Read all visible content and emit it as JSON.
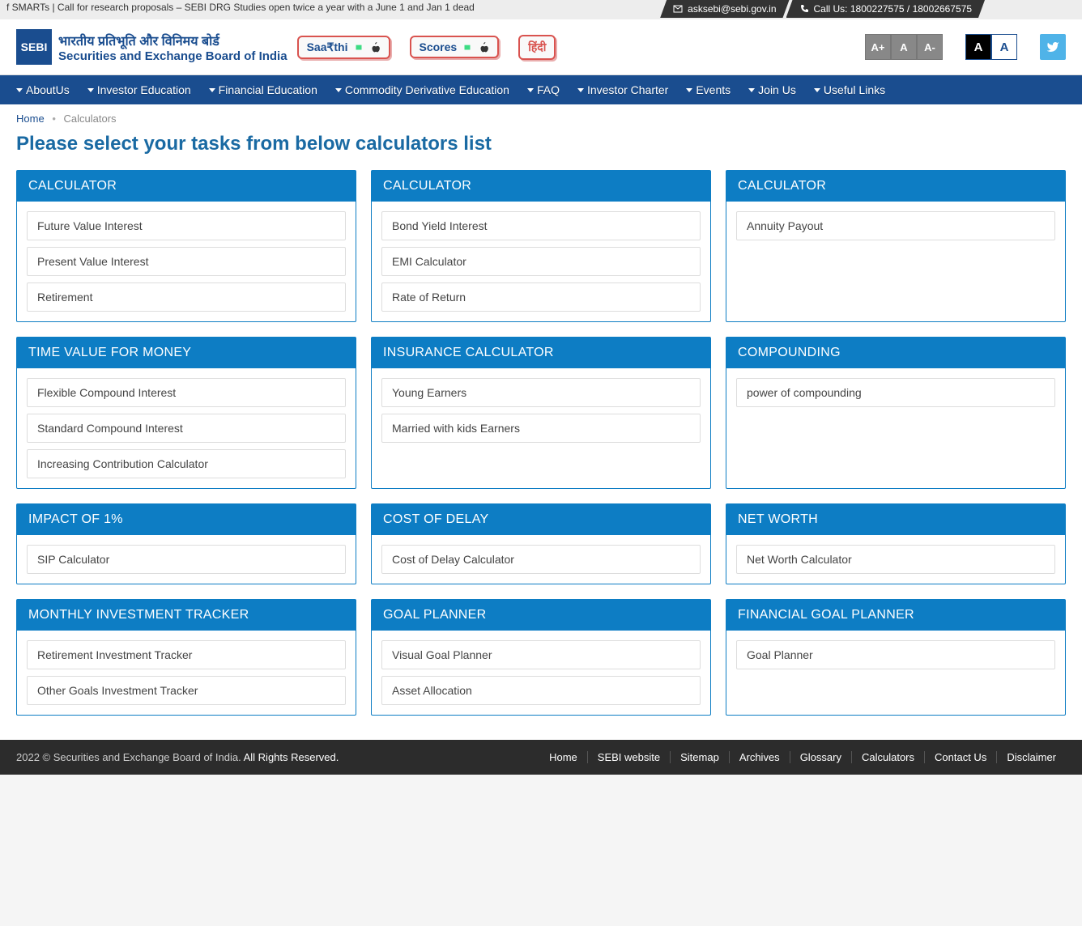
{
  "topbar": {
    "ticker": "f SMARTs   |   Call for research proposals – SEBI DRG Studies open twice a year with a June 1 and Jan 1 dead",
    "email": "asksebi@sebi.gov.in",
    "call": "Call Us: 1800227575 / 18002667575"
  },
  "logo": {
    "square": "SEBI",
    "hindi": "भारतीय प्रतिभूति और विनिमय बोर्ड",
    "english": "Securities and Exchange Board of India"
  },
  "pills": {
    "saarthi": "Saa₹thi",
    "scores": "Scores",
    "hindi": "हिंदी"
  },
  "sizes": {
    "inc": "A+",
    "norm": "A",
    "dec": "A-"
  },
  "contrast": {
    "dark": "A",
    "light": "A"
  },
  "nav": [
    "AboutUs",
    "Investor Education",
    "Financial Education",
    "Commodity Derivative Education",
    "FAQ",
    "Investor Charter",
    "Events",
    "Join Us",
    "Useful Links"
  ],
  "breadcrumb": {
    "home": "Home",
    "current": "Calculators"
  },
  "page_title": "Please select your tasks from below calculators list",
  "cards": [
    {
      "title": "CALCULATOR",
      "items": [
        "Future Value Interest",
        "Present Value Interest",
        "Retirement"
      ]
    },
    {
      "title": "CALCULATOR",
      "items": [
        "Bond Yield Interest",
        "EMI Calculator",
        "Rate of Return"
      ]
    },
    {
      "title": "CALCULATOR",
      "items": [
        "Annuity Payout"
      ]
    },
    {
      "title": "TIME VALUE FOR MONEY",
      "items": [
        "Flexible Compound Interest",
        "Standard Compound Interest",
        "Increasing Contribution Calculator"
      ]
    },
    {
      "title": "INSURANCE CALCULATOR",
      "items": [
        "Young Earners",
        "Married with kids Earners"
      ]
    },
    {
      "title": "COMPOUNDING",
      "items": [
        "power of compounding"
      ]
    },
    {
      "title": "IMPACT OF 1%",
      "items": [
        "SIP Calculator"
      ]
    },
    {
      "title": "COST OF DELAY",
      "items": [
        "Cost of Delay Calculator"
      ]
    },
    {
      "title": "NET WORTH",
      "items": [
        "Net Worth Calculator"
      ]
    },
    {
      "title": "MONTHLY INVESTMENT TRACKER",
      "items": [
        "Retirement Investment Tracker",
        "Other Goals Investment Tracker"
      ]
    },
    {
      "title": "GOAL PLANNER",
      "items": [
        "Visual Goal Planner",
        "Asset Allocation"
      ]
    },
    {
      "title": "FINANCIAL GOAL PLANNER",
      "items": [
        "Goal Planner"
      ]
    }
  ],
  "footer": {
    "copyright_gray": "2022 © Securities and Exchange Board of India.",
    "copyright_white": " All Rights Reserved.",
    "links": [
      "Home",
      "SEBI website",
      "Sitemap",
      "Archives",
      "Glossary",
      "Calculators",
      "Contact Us",
      "Disclaimer"
    ]
  }
}
